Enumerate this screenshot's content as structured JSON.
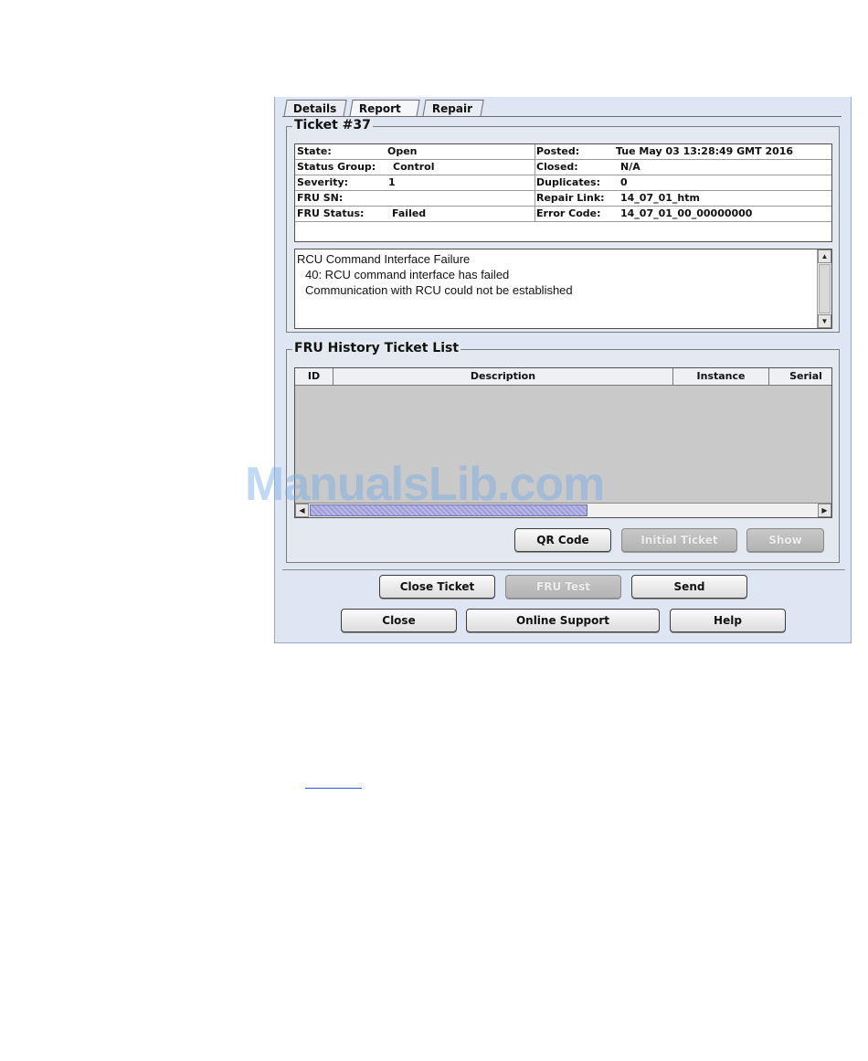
{
  "tabs": [
    {
      "label": "Details"
    },
    {
      "label": "Report"
    },
    {
      "label": "Repair"
    }
  ],
  "ticket": {
    "title": "Ticket #37",
    "left": [
      {
        "label": "State:",
        "value": "Open"
      },
      {
        "label": "Status Group:",
        "value": "Control"
      },
      {
        "label": "Severity:",
        "value": "1"
      },
      {
        "label": "FRU SN:",
        "value": ""
      },
      {
        "label": "FRU Status:",
        "value": "Failed"
      }
    ],
    "right": [
      {
        "label": "Posted:",
        "value": "Tue May 03 13:28:49 GMT 2016"
      },
      {
        "label": "Closed:",
        "value": "N/A"
      },
      {
        "label": "Duplicates:",
        "value": "0"
      },
      {
        "label": "Repair Link:",
        "value": "14_07_01_htm"
      },
      {
        "label": "Error Code:",
        "value": "14_07_01_00_00000000"
      }
    ],
    "message_lines": [
      "RCU Command Interface Failure",
      "40: RCU command interface has failed",
      "Communication with RCU could not be established"
    ]
  },
  "history": {
    "title": "FRU History Ticket List",
    "columns": [
      "ID",
      "Description",
      "Instance",
      "Serial"
    ],
    "rows": []
  },
  "buttons": {
    "qr_code": "QR Code",
    "initial_ticket": "Initial Ticket",
    "show": "Show",
    "close_ticket": "Close Ticket",
    "fru_test": "FRU Test",
    "send": "Send",
    "close": "Close",
    "online_support": "Online Support",
    "help": "Help"
  },
  "watermark": "ManualsLib.com"
}
